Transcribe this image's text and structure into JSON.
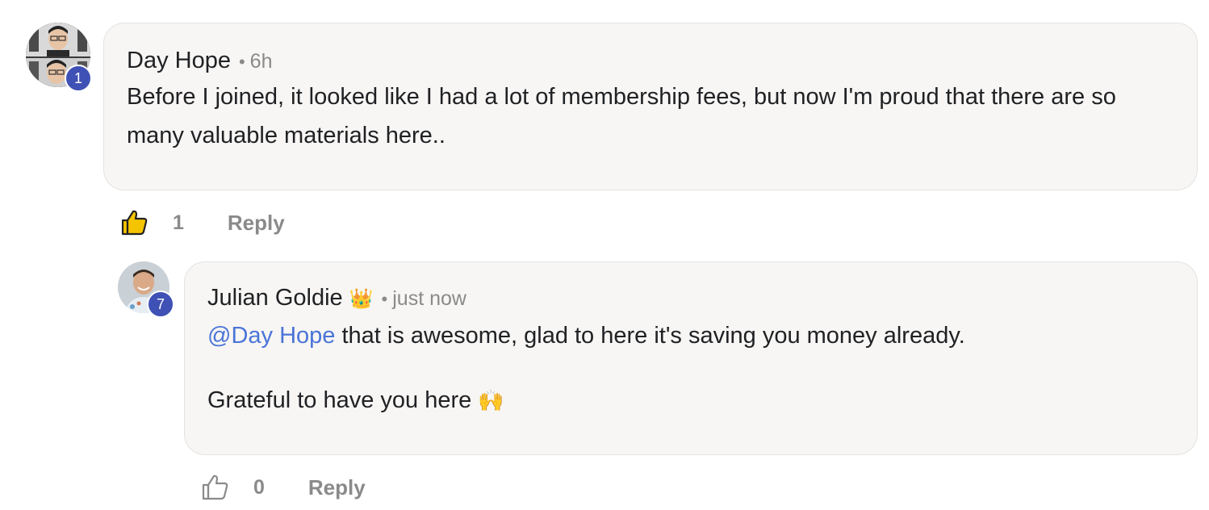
{
  "comments": [
    {
      "author": "Day Hope",
      "time": "6h",
      "level": "1",
      "body": "Before I joined, it looked like I had a lot of membership fees, but now I'm proud that there are so many valuable materials here..",
      "likes": "1",
      "liked": true,
      "reply_label": "Reply"
    },
    {
      "author": "Julian Goldie",
      "author_icon": "crown-emoji",
      "crown": "👑",
      "time": "just now",
      "level": "7",
      "mention": "@Day Hope",
      "body_line1": " that is awesome, glad to here it's saving you money already.",
      "body_line2": "Grateful to have you here",
      "body_emoji": "🙌",
      "likes": "0",
      "liked": false,
      "reply_label": "Reply"
    }
  ],
  "separator": "•",
  "colors": {
    "accent": "#3f51b5",
    "mention": "#4a74d8",
    "like_active": "#f5c400",
    "bubble_bg": "#f7f6f4"
  }
}
